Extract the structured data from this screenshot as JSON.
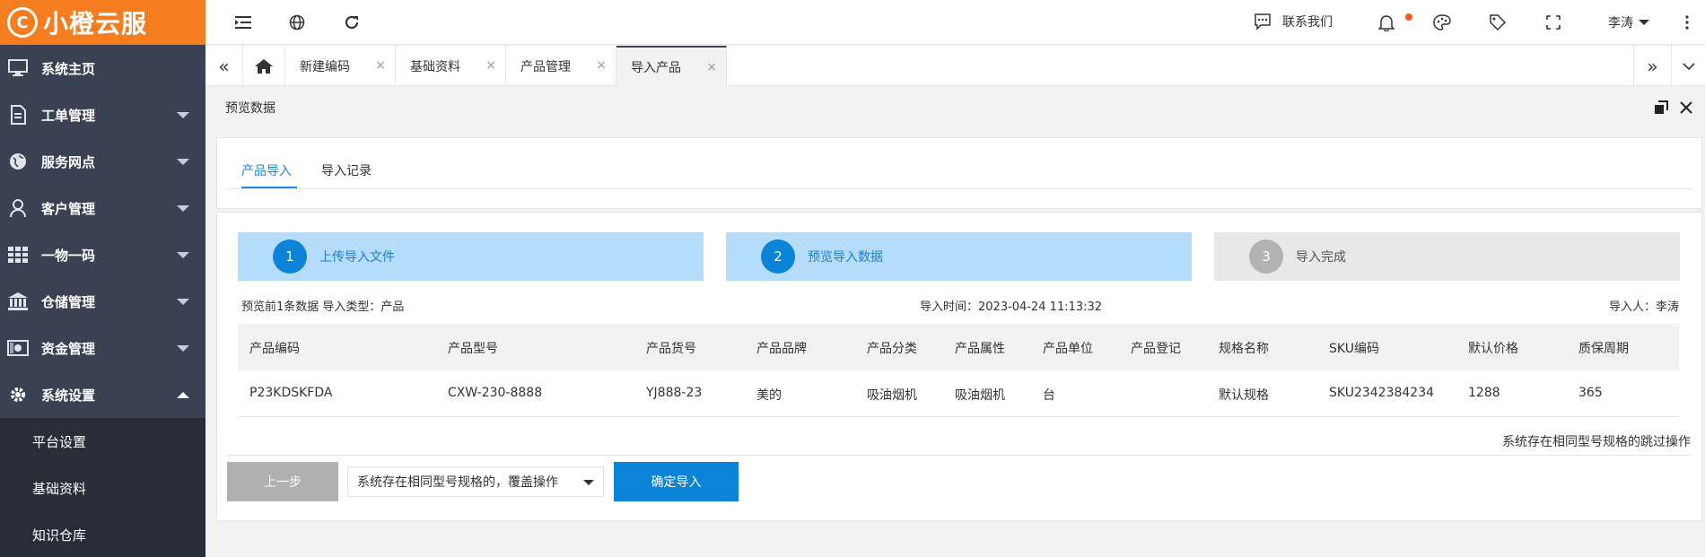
{
  "brand": {
    "name": "小橙云服",
    "mark": "C"
  },
  "sidebar": {
    "items": [
      {
        "label": "系统主页",
        "icon": "monitor-icon",
        "has_caret": false
      },
      {
        "label": "工单管理",
        "icon": "document-icon",
        "has_caret": true
      },
      {
        "label": "服务网点",
        "icon": "globe-icon",
        "has_caret": true
      },
      {
        "label": "客户管理",
        "icon": "user-icon",
        "has_caret": true
      },
      {
        "label": "一物一码",
        "icon": "grid-icon",
        "has_caret": true
      },
      {
        "label": "仓储管理",
        "icon": "bank-icon",
        "has_caret": true
      },
      {
        "label": "资金管理",
        "icon": "money-icon",
        "has_caret": true
      },
      {
        "label": "系统设置",
        "icon": "gear-icon",
        "has_caret": true,
        "expanded": true
      }
    ],
    "submenu": [
      "平台设置",
      "基础资料",
      "知识仓库"
    ]
  },
  "header": {
    "contact": "联系我们",
    "user": "李涛"
  },
  "tabs": [
    {
      "label": "新建编码"
    },
    {
      "label": "基础资料"
    },
    {
      "label": "产品管理"
    },
    {
      "label": "导入产品",
      "active": true
    }
  ],
  "panel": {
    "title": "预览数据"
  },
  "subtabs": [
    {
      "label": "产品导入",
      "active": true
    },
    {
      "label": "导入记录"
    }
  ],
  "steps": [
    {
      "num": "1",
      "label": "上传导入文件",
      "state": "done"
    },
    {
      "num": "2",
      "label": "预览导入数据",
      "state": "current"
    },
    {
      "num": "3",
      "label": "导入完成",
      "state": "pending"
    }
  ],
  "meta": {
    "left": "预览前1条数据 导入类型：产品",
    "time": "导入时间：2023-04-24 11:13:32",
    "importer": "导入人：李涛"
  },
  "table": {
    "headers": [
      "产品编码",
      "产品型号",
      "产品货号",
      "产品品牌",
      "产品分类",
      "产品属性",
      "产品单位",
      "产品登记",
      "规格名称",
      "SKU编码",
      "默认价格",
      "质保周期"
    ],
    "rows": [
      [
        "P23KDSKFDA",
        "CXW-230-8888",
        "YJ888-23",
        "美的",
        "吸油烟机",
        "吸油烟机",
        "台",
        "",
        "默认规格",
        "SKU2342384234",
        "1288",
        "365"
      ]
    ]
  },
  "skip_note": "系统存在相同型号规格的跳过操作",
  "actions": {
    "prev": "上一步",
    "select_value": "系统存在相同型号规格的，覆盖操作",
    "confirm": "确定导入"
  },
  "colors": {
    "brand": "#f57c1f",
    "sidebar": "#3a4152",
    "accent": "#0b84d8",
    "notify_dot": "#ff5722"
  }
}
